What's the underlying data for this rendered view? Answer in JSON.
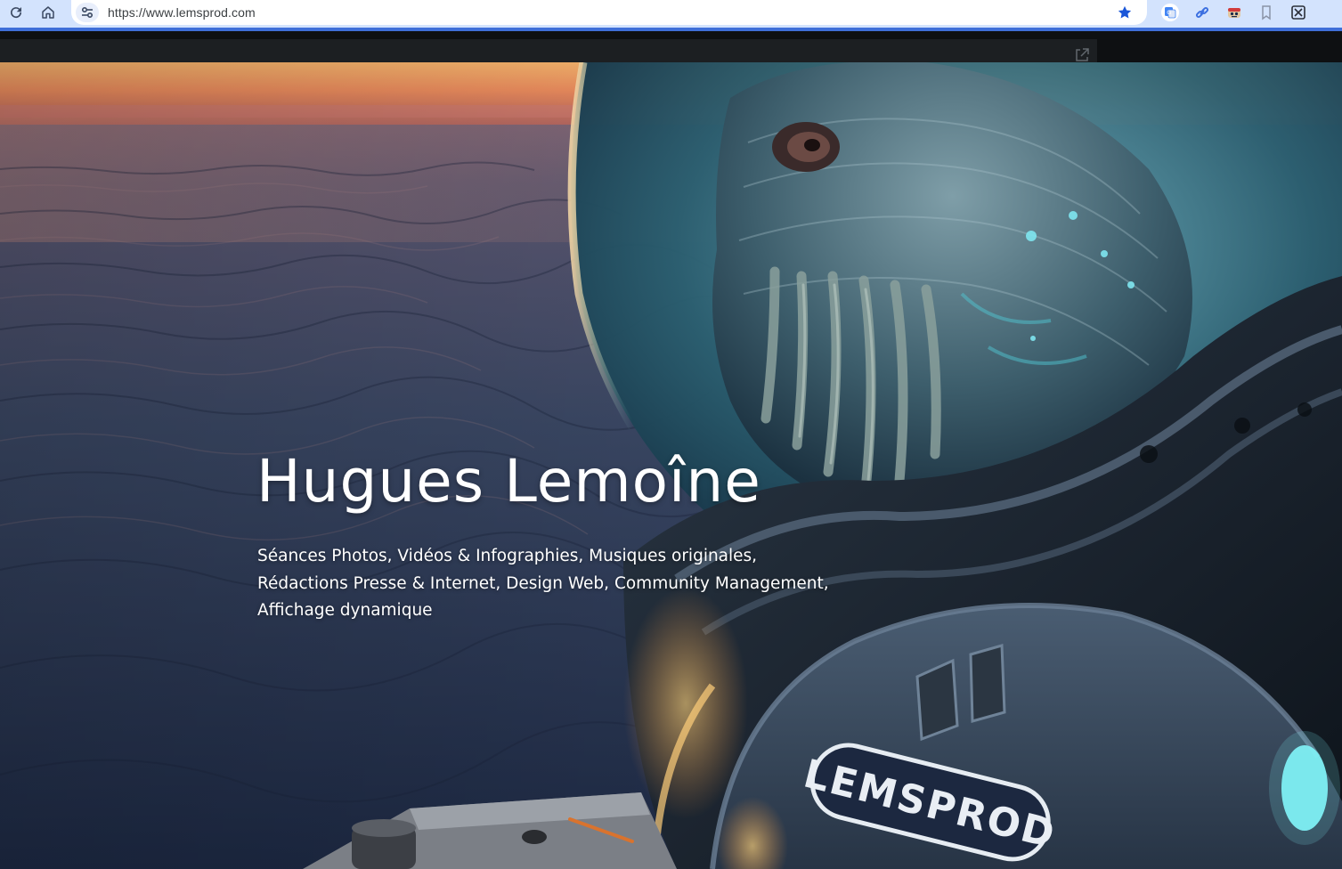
{
  "browser": {
    "url": "https://www.lemsprod.com",
    "accent_color": "#3f6fd8",
    "toolbar_color": "#d3e3fd",
    "icons": [
      "reload-icon",
      "home-icon",
      "site-settings-icon",
      "bookmark-star-icon",
      "translate-extension-icon",
      "link-extension-icon",
      "robot-extension-icon",
      "bookmark-extension-icon",
      "crop-extension-icon"
    ]
  },
  "page": {
    "popout_icon": "external-link-icon"
  },
  "hero": {
    "title": "Hugues Lemoîne",
    "subtitle_lines": [
      "Séances Photos, Vidéos & Infographies, Musiques originales,",
      "Rédactions Presse & Internet, Design Web, Community Management,",
      "Affichage dynamique"
    ],
    "patch_text": "LEMSPROD"
  }
}
